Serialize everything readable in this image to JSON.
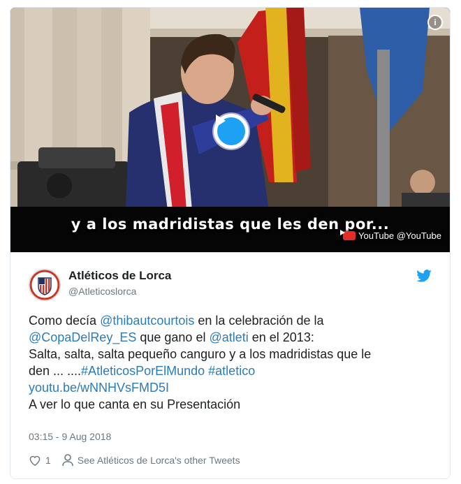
{
  "video": {
    "subtitle": "y a los madridistas que les den por...",
    "provider_label": "YouTube @YouTube",
    "info_label": "i",
    "play_icon": "play-icon"
  },
  "tweet": {
    "author_name": "Atléticos de Lorca",
    "author_handle": "@Atleticoslorca",
    "text": {
      "l1_a": "Como decía ",
      "l1_mention": "@thibautcourtois",
      "l1_b": " en la celebración de la",
      "l2_mention1": "@CopaDelRey_ES",
      "l2_a": " que gano el ",
      "l2_mention2": "@atleti",
      "l2_b": " en el 2013:",
      "l3": "Salta, salta, salta pequeño canguro y a los madridistas que le",
      "l4_a": "den ... ....",
      "l4_hashtag1": "#AtleticosPorElMundo",
      "l4_space": " ",
      "l4_hashtag2": "#atletico",
      "l5_link": "youtu.be/wNNHVsFMD5I",
      "l6": "A ver lo que canta en su Presentación"
    },
    "timestamp": "03:15 - 9 Aug 2018",
    "like_count": "1",
    "other_tweets_label": "See Atléticos de Lorca's other Tweets"
  },
  "colors": {
    "link": "#2b7bb9",
    "twitter_blue": "#1da1f2",
    "muted": "#697882"
  }
}
